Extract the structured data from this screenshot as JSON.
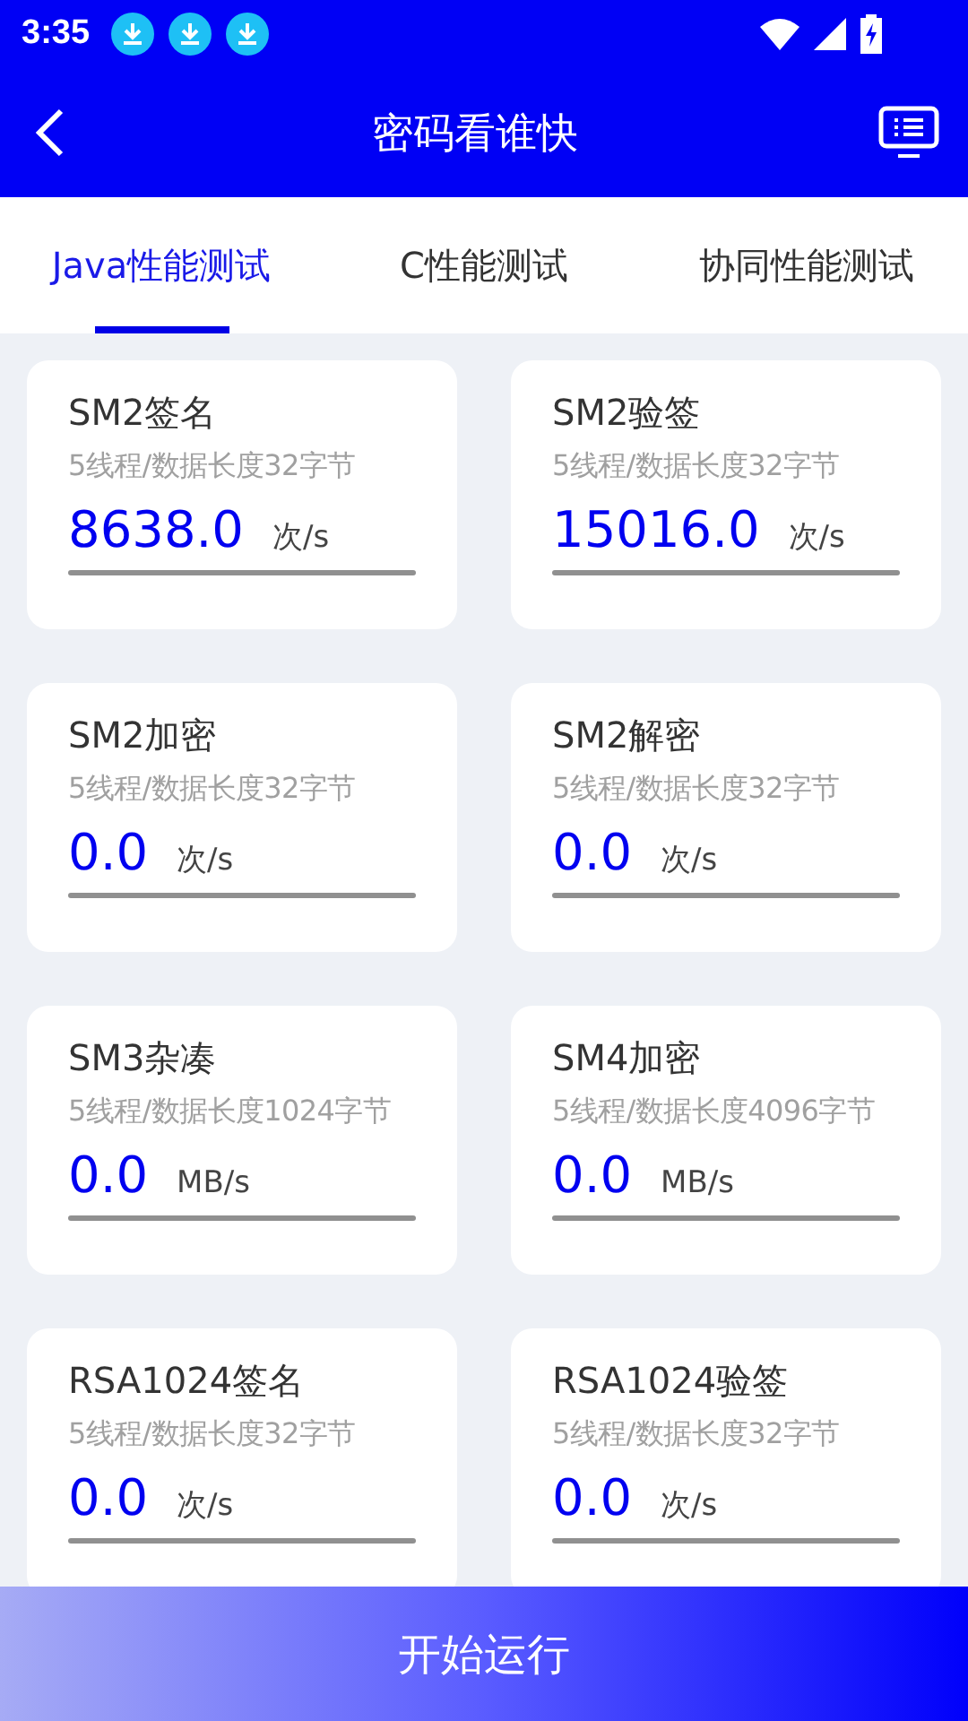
{
  "status_bar": {
    "time": "3:35",
    "notifications": [
      {
        "kind": "download"
      },
      {
        "kind": "download"
      },
      {
        "kind": "download"
      }
    ]
  },
  "app_bar": {
    "title": "密码看谁快"
  },
  "tabs": [
    {
      "label": "Java性能测试",
      "selected": true
    },
    {
      "label": "C性能测试",
      "selected": false
    },
    {
      "label": "协同性能测试",
      "selected": false
    }
  ],
  "cards": [
    {
      "title": "SM2签名",
      "subtitle": "5线程/数据长度32字节",
      "value": "8638.0",
      "unit": "次/s"
    },
    {
      "title": "SM2验签",
      "subtitle": "5线程/数据长度32字节",
      "value": "15016.0",
      "unit": "次/s"
    },
    {
      "title": "SM2加密",
      "subtitle": "5线程/数据长度32字节",
      "value": "0.0",
      "unit": "次/s"
    },
    {
      "title": "SM2解密",
      "subtitle": "5线程/数据长度32字节",
      "value": "0.0",
      "unit": "次/s"
    },
    {
      "title": "SM3杂凑",
      "subtitle": "5线程/数据长度1024字节",
      "value": "0.0",
      "unit": "MB/s"
    },
    {
      "title": "SM4加密",
      "subtitle": "5线程/数据长度4096字节",
      "value": "0.0",
      "unit": "MB/s"
    },
    {
      "title": "RSA1024签名",
      "subtitle": "5线程/数据长度32字节",
      "value": "0.0",
      "unit": "次/s"
    },
    {
      "title": "RSA1024验签",
      "subtitle": "5线程/数据长度32字节",
      "value": "0.0",
      "unit": "次/s"
    }
  ],
  "start_button": {
    "label": "开始运行"
  }
}
